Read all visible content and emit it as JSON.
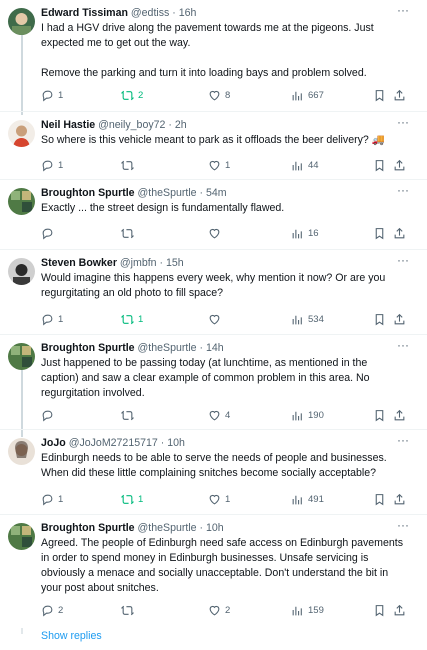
{
  "tweets": [
    {
      "name": "Edward Tissiman",
      "handle": "@edtiss",
      "time": "· 16h",
      "body": [
        "I had a HGV drive along the pavement towards me at the pigeons. Just expected me to get out the way.",
        "Remove the parking and turn it into loading bays and problem solved."
      ],
      "replies": "1",
      "retweets": "2",
      "retweeted": true,
      "likes": "8",
      "views": "667",
      "avatar_color": "#3f6b4a"
    },
    {
      "name": "Neil Hastie",
      "handle": "@neily_boy72",
      "time": "· 2h",
      "body": [
        "So where is this vehicle meant to park as it offloads the beer delivery? 🚚"
      ],
      "replies": "1",
      "retweets": "",
      "retweeted": false,
      "likes": "1",
      "views": "44",
      "avatar_color": "#d9c9b8"
    },
    {
      "name": "Broughton Spurtle",
      "handle": "@theSpurtle",
      "time": "· 54m",
      "body": [
        "Exactly ... the street design is fundamentally flawed."
      ],
      "replies": "",
      "retweets": "",
      "retweeted": false,
      "likes": "",
      "views": "16",
      "avatar_color": "#4f7a45"
    },
    {
      "name": "Steven Bowker",
      "handle": "@jmbfn",
      "time": "· 15h",
      "body": [
        "Would imagine this happens every week, why mention it now? Or are you regurgitating an old photo to fill space?"
      ],
      "replies": "1",
      "retweets": "1",
      "retweeted": true,
      "likes": "",
      "views": "534",
      "avatar_color": "#2a2a2a"
    },
    {
      "name": "Broughton Spurtle",
      "handle": "@theSpurtle",
      "time": "· 14h",
      "body": [
        "Just happened to be passing today (at lunchtime, as mentioned in the caption) and saw a clear example of common problem in this area. No regurgitation involved."
      ],
      "replies": "",
      "retweets": "",
      "retweeted": false,
      "likes": "4",
      "views": "190",
      "avatar_color": "#4f7a45"
    },
    {
      "name": "JoJo",
      "handle": "@JoJoM27215717",
      "time": "· 10h",
      "body": [
        "Edinburgh needs to be able to serve the needs of people and businesses. When did these little complaining snitches become socially acceptable?"
      ],
      "replies": "1",
      "retweets": "1",
      "retweeted": true,
      "likes": "1",
      "views": "491",
      "avatar_color": "#cdbdb0"
    },
    {
      "name": "Broughton Spurtle",
      "handle": "@theSpurtle",
      "time": "· 10h",
      "body": [
        "Agreed. The people of Edinburgh need safe access on Edinburgh pavements in order to spend money in Edinburgh businesses. Unsafe servicing is obviously a menace and socially unacceptable. Don't understand the bit in your post about snitches."
      ],
      "replies": "2",
      "retweets": "",
      "retweeted": false,
      "likes": "2",
      "views": "159",
      "avatar_color": "#4f7a45"
    }
  ],
  "more_label": "···",
  "show_replies": "Show replies",
  "colors": {
    "retweet_active": "#00ba7c",
    "link": "#1d9bf0",
    "muted": "#536471"
  },
  "icons": [
    "reply-icon",
    "retweet-icon",
    "like-icon",
    "views-icon",
    "bookmark-icon",
    "share-icon",
    "more-icon"
  ]
}
